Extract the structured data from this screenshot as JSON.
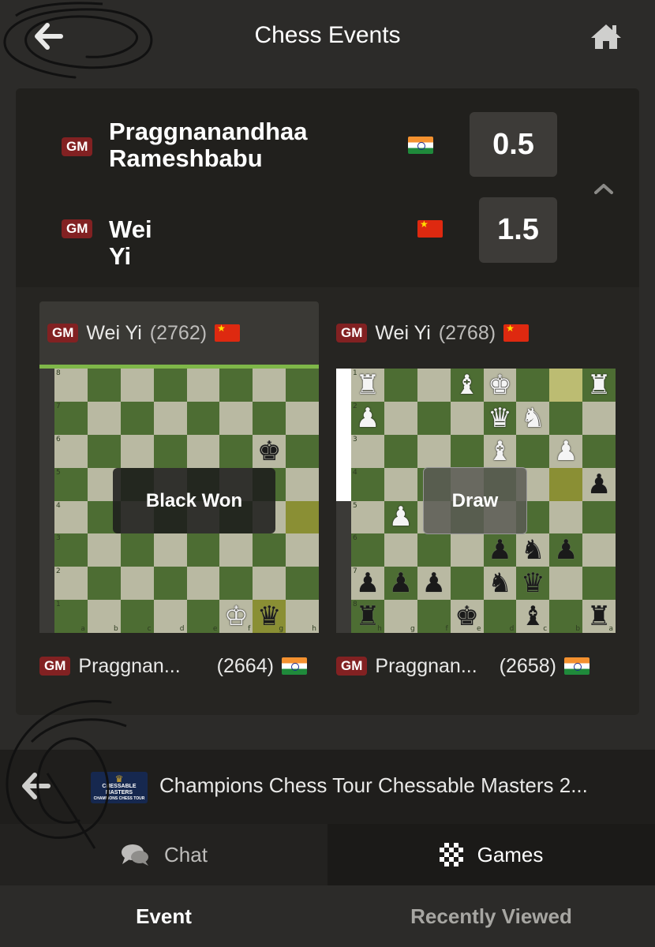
{
  "header": {
    "title": "Chess Events",
    "back_icon": "arrow-left-icon",
    "home_icon": "home-icon"
  },
  "match": {
    "players": [
      {
        "title": "GM",
        "name_line1": "Praggnanandhaa",
        "name_line2": "Rameshbabu",
        "flag": "india",
        "score": "0.5"
      },
      {
        "title": "GM",
        "name_line1": "Wei Yi",
        "name_line2": "",
        "flag": "china",
        "score": "1.5"
      }
    ]
  },
  "games": [
    {
      "top": {
        "title": "GM",
        "name": "Wei Yi",
        "rating": "(2762)",
        "flag": "china"
      },
      "bottom": {
        "title": "GM",
        "name": "Praggnan...",
        "rating": "(2664)",
        "flag": "india"
      },
      "result": "Black Won",
      "eval_white_fraction": 0.0,
      "ranks": [
        "8",
        "7",
        "6",
        "5",
        "4",
        "3",
        "2",
        "1"
      ],
      "files": [
        "a",
        "b",
        "c",
        "d",
        "e",
        "f",
        "g",
        "h"
      ]
    },
    {
      "top": {
        "title": "GM",
        "name": "Wei Yi",
        "rating": "(2768)",
        "flag": "china"
      },
      "bottom": {
        "title": "GM",
        "name": "Praggnan...",
        "rating": "(2658)",
        "flag": "india"
      },
      "result": "Draw",
      "eval_white_fraction": 0.5,
      "ranks": [
        "1",
        "2",
        "3",
        "4",
        "5",
        "6",
        "7",
        "8"
      ],
      "files": [
        "h",
        "g",
        "f",
        "e",
        "d",
        "c",
        "b",
        "a"
      ]
    }
  ],
  "event": {
    "title": "Champions Chess Tour Chessable Masters 2...",
    "logo_text": "CHESSABLE MASTERS",
    "logo_subtext": "CHAMPIONS CHESS TOUR"
  },
  "tabs": {
    "chat": "Chat",
    "games": "Games"
  },
  "bottom_nav": {
    "event": "Event",
    "recent": "Recently Viewed"
  },
  "colors": {
    "background": "#2c2b29",
    "gm_badge": "#822122",
    "light_square": "#b9b9a2",
    "dark_square": "#4d6d33"
  }
}
